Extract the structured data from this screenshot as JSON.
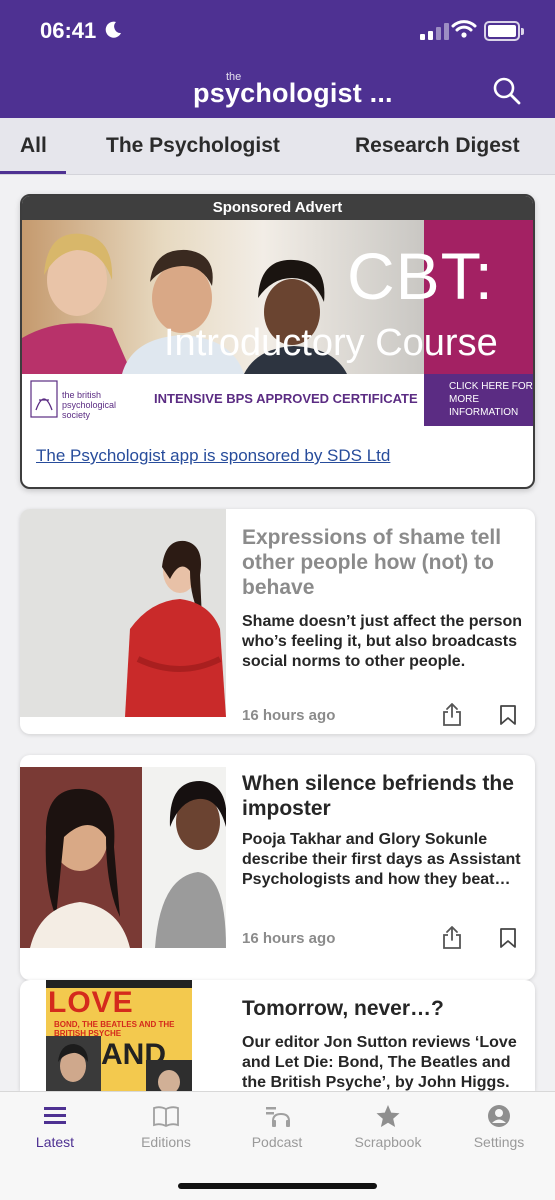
{
  "status_bar": {
    "time": "06:41"
  },
  "header": {
    "logo_small": "the",
    "logo": "psychologist ..."
  },
  "tabs": [
    {
      "label": "All"
    },
    {
      "label": "The Psychologist"
    },
    {
      "label": "Research Digest"
    }
  ],
  "sponsored": {
    "header": "Sponsored Advert",
    "banner_title": "CBT:",
    "banner_subtitle": "Introductory Course",
    "bps_name": "the british psychological society",
    "certificate": "INTENSIVE BPS APPROVED CERTIFICATE",
    "click_here": "CLICK HERE FOR MORE INFORMATION",
    "link": "The Psychologist app is sponsored by SDS Ltd"
  },
  "articles": [
    {
      "title": "Expressions of shame tell other people how (not) to behave",
      "description": "Shame doesn’t just affect the person who’s feeling it, but also broadcasts social norms to other people.",
      "time": "16 hours ago"
    },
    {
      "title": "When silence befriends the imposter",
      "description": "Pooja Takhar and Glory Sokunle describe their first days as Assistant Psychologists and how they beat…",
      "time": "16 hours ago"
    },
    {
      "title": "Tomorrow, never…?",
      "description": "Our editor Jon Sutton reviews ‘Love and Let Die: Bond, The Beatles and the British Psyche’, by John Higgs.",
      "book_cover": {
        "line1": "LOVE",
        "line2": "BOND, THE BEATLES AND THE BRITISH PSYCHE",
        "line3": "AND"
      }
    }
  ],
  "bottom_nav": [
    {
      "label": "Latest",
      "icon": "list-icon"
    },
    {
      "label": "Editions",
      "icon": "book-icon"
    },
    {
      "label": "Podcast",
      "icon": "headphones-icon"
    },
    {
      "label": "Scrapbook",
      "icon": "star-icon"
    },
    {
      "label": "Settings",
      "icon": "user-icon"
    }
  ],
  "colors": {
    "brand": "#4e3192",
    "active_nav": "#4e3192",
    "inactive": "#9a9a9a"
  }
}
